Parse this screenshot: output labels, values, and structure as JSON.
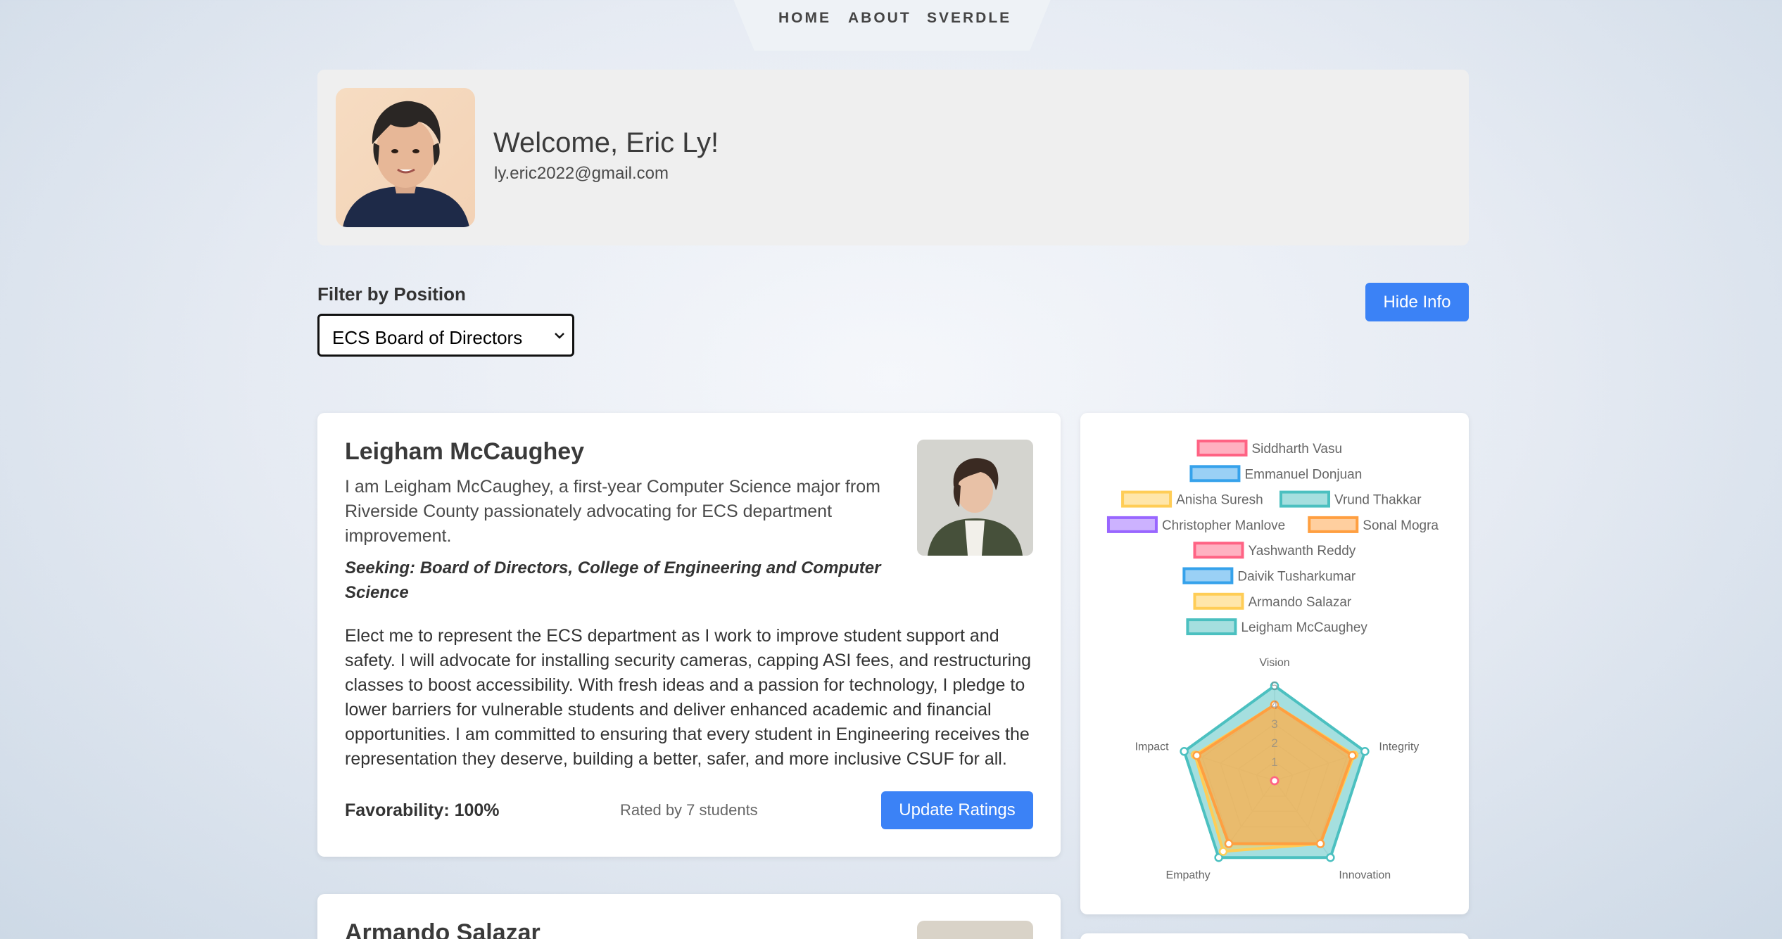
{
  "nav": {
    "items": [
      "HOME",
      "ABOUT",
      "SVERDLE"
    ]
  },
  "profile": {
    "welcome": "Welcome, Eric Ly!",
    "email": "ly.eric2022@gmail.com"
  },
  "filter": {
    "label": "Filter by Position",
    "selected": "ECS Board of Directors"
  },
  "hide_info_label": "Hide Info",
  "candidate": {
    "name": "Leigham McCaughey",
    "bio": "I am Leigham McCaughey, a first-year Computer Science major from Riverside County passionately advocating for ECS department improvement.",
    "seeking": "Seeking: Board of Directors, College of Engineering and Computer Science",
    "statement": "Elect me to represent the ECS department as I work to improve student support and safety. I will advocate for installing security cameras, capping ASI fees, and restructuring classes to boost accessibility. With fresh ideas and a passion for technology, I pledge to lower barriers for vulnerable students and deliver enhanced academic and financial opportunities. I am committed to ensuring that every student in Engineering receives the representation they deserve, building a better, safer, and more inclusive CSUF for all.",
    "favorability": "Favorability: 100%",
    "rated_by": "Rated by 7 students",
    "update_label": "Update Ratings"
  },
  "next_candidate": {
    "name": "Armando Salazar"
  },
  "colors": {
    "accent": "#3b82f6",
    "pink": "#ff6384",
    "blue": "#36a2eb",
    "yellow": "#ffcd56",
    "teal": "#4bc0c0",
    "purple": "#9966ff",
    "orange": "#ff9f40"
  },
  "chart_data": {
    "type": "radar",
    "axes": [
      "Vision",
      "Integrity",
      "Innovation",
      "Empathy",
      "Impact"
    ],
    "rlim": [
      0,
      5
    ],
    "ticks": [
      1,
      2,
      3,
      4,
      5
    ],
    "legend_position": "top",
    "legend": [
      {
        "name": "Siddharth Vasu",
        "color": "#ff6384"
      },
      {
        "name": "Emmanuel Donjuan",
        "color": "#36a2eb"
      },
      {
        "name": "Anisha Suresh",
        "color": "#ffcd56"
      },
      {
        "name": "Vrund Thakkar",
        "color": "#4bc0c0"
      },
      {
        "name": "Christopher Manlove",
        "color": "#9966ff"
      },
      {
        "name": "Sonal Mogra",
        "color": "#ff9f40"
      },
      {
        "name": "Yashwanth Reddy",
        "color": "#ff6384"
      },
      {
        "name": "Daivik Tusharkumar",
        "color": "#36a2eb"
      },
      {
        "name": "Armando Salazar",
        "color": "#ffcd56"
      },
      {
        "name": "Leigham McCaughey",
        "color": "#4bc0c0"
      }
    ],
    "series": [
      {
        "name": "Siddharth Vasu",
        "color": "#ff6384",
        "values": [
          0,
          0,
          0,
          0,
          0
        ]
      },
      {
        "name": "Armando Salazar",
        "color": "#ffcd56",
        "values": [
          4,
          4.4,
          4.1,
          4.6,
          4.4
        ]
      },
      {
        "name": "Sonal Mogra",
        "color": "#ff9f40",
        "values": [
          4,
          4.3,
          4.1,
          4.1,
          4.3
        ]
      },
      {
        "name": "Leigham McCaughey",
        "color": "#4bc0c0",
        "values": [
          5,
          5,
          5,
          5,
          5
        ]
      }
    ]
  }
}
